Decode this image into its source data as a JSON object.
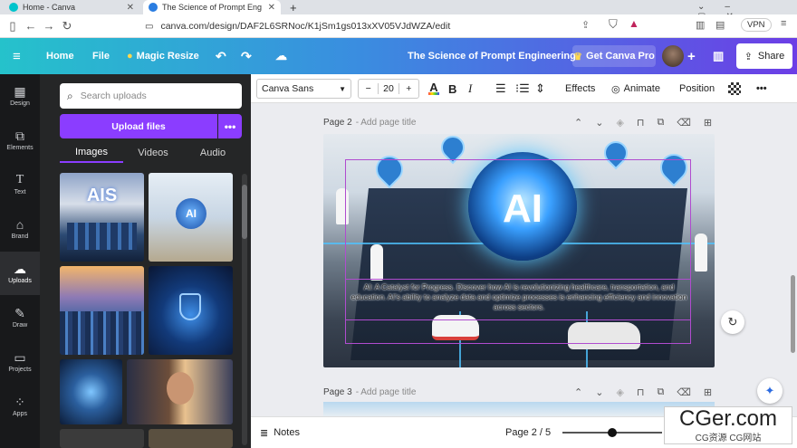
{
  "browser": {
    "tabs": [
      {
        "title": "Home - Canva",
        "active": false
      },
      {
        "title": "The Science of Prompt Engineer",
        "active": true
      }
    ],
    "new_tab": "+",
    "url": "canva.com/design/DAF2L6SRNoc/K1jSm1gs013xXV05VJdWZA/edit",
    "vpn_label": "VPN"
  },
  "header": {
    "home": "Home",
    "file": "File",
    "magic_resize": "Magic Resize",
    "doc_title": "The Science of Prompt Engineering",
    "get_pro": "Get Canva Pro",
    "share": "Share",
    "accent_color": "#8b3dff"
  },
  "rail": [
    {
      "label": "Design",
      "icon": "design-icon"
    },
    {
      "label": "Elements",
      "icon": "elements-icon"
    },
    {
      "label": "Text",
      "icon": "text-icon"
    },
    {
      "label": "Brand",
      "icon": "brand-icon"
    },
    {
      "label": "Uploads",
      "icon": "upload-cloud-icon",
      "active": true
    },
    {
      "label": "Draw",
      "icon": "draw-icon"
    },
    {
      "label": "Projects",
      "icon": "folder-icon"
    },
    {
      "label": "Apps",
      "icon": "apps-grid-icon"
    }
  ],
  "panel": {
    "search_placeholder": "Search uploads",
    "upload_button": "Upload files",
    "more_button": "•••",
    "tabs": [
      "Images",
      "Videos",
      "Audio"
    ],
    "active_tab": "Images",
    "thumb_texts": [
      "AIS",
      "AI"
    ]
  },
  "toolbar": {
    "font": "Canva Sans",
    "minus": "−",
    "font_size": "20",
    "plus": "+",
    "bold": "B",
    "italic": "I",
    "effects": "Effects",
    "animate": "Animate",
    "position": "Position",
    "more": "•••"
  },
  "pages": [
    {
      "label": "Page 2",
      "add_title": "- Add page title"
    },
    {
      "label": "Page 3",
      "add_title": "- Add page title"
    }
  ],
  "design": {
    "big_text": "AI",
    "body_text": "AI: A Catalyst for Progress. Discover how AI is revolutionizing healthcare, transportation, and education. AI's ability to analyze data and optimize processes is enhancing efficiency and innovation across sectors."
  },
  "footer": {
    "notes": "Notes",
    "page_indicator": "Page 2 / 5"
  },
  "watermark": {
    "big": "CGer.com",
    "small": "CG资源 CG网站"
  }
}
